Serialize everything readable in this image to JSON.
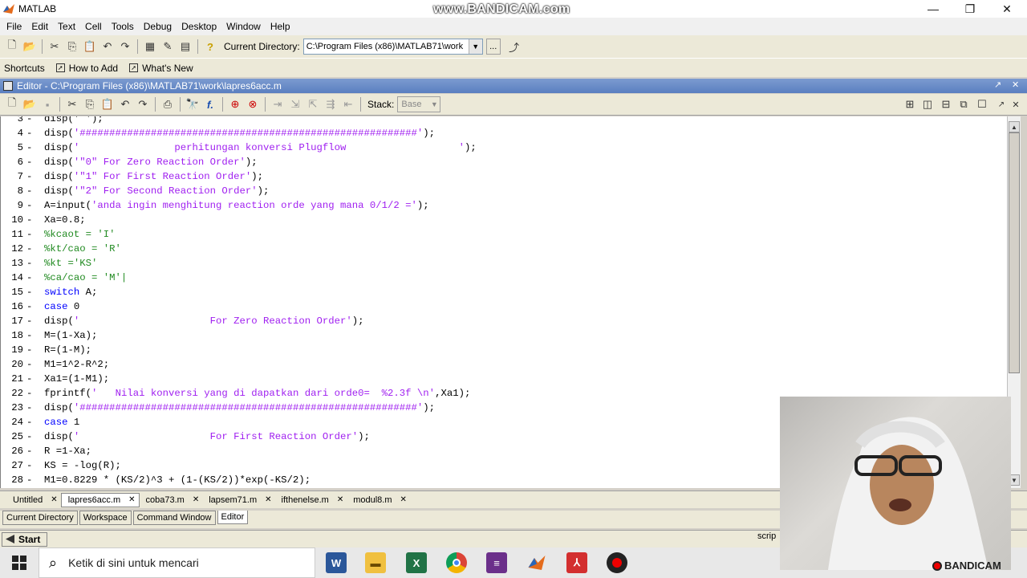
{
  "window": {
    "title": "MATLAB",
    "watermark": "www.BANDICAM.com",
    "minimize": "—",
    "restore": "❐",
    "close": "✕"
  },
  "menu": [
    "File",
    "Edit",
    "Text",
    "Cell",
    "Tools",
    "Debug",
    "Desktop",
    "Window",
    "Help"
  ],
  "toolbar": {
    "current_directory_label": "Current Directory:",
    "current_directory_value": "C:\\Program Files (x86)\\MATLAB71\\work",
    "browse_label": "..."
  },
  "shortcuts": {
    "label": "Shortcuts",
    "items": [
      "How to Add",
      "What's New"
    ]
  },
  "editor": {
    "title": "Editor - C:\\Program Files (x86)\\MATLAB71\\work\\lapres6acc.m",
    "stack_label": "Stack:",
    "stack_value": "Base"
  },
  "code_lines": [
    {
      "n": "3",
      "parts": [
        {
          "t": "disp(' ');",
          "c": ""
        }
      ]
    },
    {
      "n": "4",
      "parts": [
        {
          "t": "disp(",
          "c": ""
        },
        {
          "t": "'#########################################################'",
          "c": "str"
        },
        {
          "t": ");",
          "c": ""
        }
      ]
    },
    {
      "n": "5",
      "parts": [
        {
          "t": "disp(",
          "c": ""
        },
        {
          "t": "'                perhitungan konversi Plugflow                   '",
          "c": "str"
        },
        {
          "t": ");",
          "c": ""
        }
      ]
    },
    {
      "n": "6",
      "parts": [
        {
          "t": "disp(",
          "c": ""
        },
        {
          "t": "'\"0\" For Zero Reaction Order'",
          "c": "str"
        },
        {
          "t": ");",
          "c": ""
        }
      ]
    },
    {
      "n": "7",
      "parts": [
        {
          "t": "disp(",
          "c": ""
        },
        {
          "t": "'\"1\" For First Reaction Order'",
          "c": "str"
        },
        {
          "t": ");",
          "c": ""
        }
      ]
    },
    {
      "n": "8",
      "parts": [
        {
          "t": "disp(",
          "c": ""
        },
        {
          "t": "'\"2\" For Second Reaction Order'",
          "c": "str"
        },
        {
          "t": ");",
          "c": ""
        }
      ]
    },
    {
      "n": "9",
      "parts": [
        {
          "t": "A=input(",
          "c": ""
        },
        {
          "t": "'anda ingin menghitung reaction orde yang mana 0/1/2 ='",
          "c": "str"
        },
        {
          "t": ");",
          "c": ""
        }
      ]
    },
    {
      "n": "10",
      "parts": [
        {
          "t": "Xa=0.8;",
          "c": ""
        }
      ]
    },
    {
      "n": "11",
      "parts": [
        {
          "t": "%kcaot = 'I'",
          "c": "cmt"
        }
      ]
    },
    {
      "n": "12",
      "parts": [
        {
          "t": "%kt/cao = 'R'",
          "c": "cmt"
        }
      ]
    },
    {
      "n": "13",
      "parts": [
        {
          "t": "%kt ='KS'",
          "c": "cmt"
        }
      ]
    },
    {
      "n": "14",
      "parts": [
        {
          "t": "%ca/cao = 'M'|",
          "c": "cmt"
        }
      ]
    },
    {
      "n": "15",
      "parts": [
        {
          "t": "switch",
          "c": "kw"
        },
        {
          "t": " A;",
          "c": ""
        }
      ]
    },
    {
      "n": "16",
      "parts": [
        {
          "t": "case",
          "c": "kw"
        },
        {
          "t": " 0",
          "c": ""
        }
      ]
    },
    {
      "n": "17",
      "parts": [
        {
          "t": "disp(",
          "c": ""
        },
        {
          "t": "'                      For Zero Reaction Order'",
          "c": "str"
        },
        {
          "t": ");",
          "c": ""
        }
      ]
    },
    {
      "n": "18",
      "parts": [
        {
          "t": "M=(1-Xa);",
          "c": ""
        }
      ]
    },
    {
      "n": "19",
      "parts": [
        {
          "t": "R=(1-M);",
          "c": ""
        }
      ]
    },
    {
      "n": "20",
      "parts": [
        {
          "t": "M1=1^2-R^2;",
          "c": ""
        }
      ]
    },
    {
      "n": "21",
      "parts": [
        {
          "t": "Xa1=(1-M1);",
          "c": ""
        }
      ]
    },
    {
      "n": "22",
      "parts": [
        {
          "t": "fprintf(",
          "c": ""
        },
        {
          "t": "'   Nilai konversi yang di dapatkan dari orde0=  %2.3f \\n'",
          "c": "str"
        },
        {
          "t": ",Xa1);",
          "c": ""
        }
      ]
    },
    {
      "n": "23",
      "parts": [
        {
          "t": "disp(",
          "c": ""
        },
        {
          "t": "'#########################################################'",
          "c": "str"
        },
        {
          "t": ");",
          "c": ""
        }
      ]
    },
    {
      "n": "24",
      "parts": [
        {
          "t": "case",
          "c": "kw"
        },
        {
          "t": " 1",
          "c": ""
        }
      ]
    },
    {
      "n": "25",
      "parts": [
        {
          "t": "disp(",
          "c": ""
        },
        {
          "t": "'                      For First Reaction Order'",
          "c": "str"
        },
        {
          "t": ");",
          "c": ""
        }
      ]
    },
    {
      "n": "26",
      "parts": [
        {
          "t": "R =1-Xa;",
          "c": ""
        }
      ]
    },
    {
      "n": "27",
      "parts": [
        {
          "t": "KS = -log(R);",
          "c": ""
        }
      ]
    },
    {
      "n": "28",
      "parts": [
        {
          "t": "M1=0.8229 * (KS/2)^3 + (1-(KS/2))*exp(-KS/2);",
          "c": ""
        }
      ]
    }
  ],
  "file_tabs": [
    {
      "label": "Untitled",
      "active": false
    },
    {
      "label": "lapres6acc.m",
      "active": true
    },
    {
      "label": "coba73.m",
      "active": false
    },
    {
      "label": "lapsem71.m",
      "active": false
    },
    {
      "label": "ifthenelse.m",
      "active": false
    },
    {
      "label": "modul8.m",
      "active": false
    }
  ],
  "desktop_tabs": [
    {
      "label": "Current Directory",
      "active": false
    },
    {
      "label": "Workspace",
      "active": false
    },
    {
      "label": "Command Window",
      "active": false
    },
    {
      "label": "Editor",
      "active": true
    }
  ],
  "status": {
    "start_label": "Start",
    "field": "scrip"
  },
  "taskbar": {
    "search_placeholder": "Ketik di sini untuk mencari",
    "apps": [
      "word-icon",
      "file-explorer-icon",
      "excel-icon",
      "chrome-icon",
      "winrar-icon",
      "matlab-icon",
      "acrobat-icon",
      "bandicam-icon"
    ]
  },
  "webcam": {
    "watermark": "BANDICAM"
  }
}
